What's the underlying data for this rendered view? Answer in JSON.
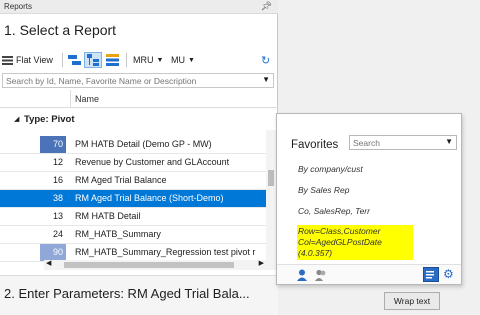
{
  "pane": {
    "title": "Reports",
    "pin_icon": "pin-icon"
  },
  "step1": "1. Select a Report",
  "toolbar": {
    "flat_view": "Flat View",
    "mru": "MRU",
    "mu": "MU"
  },
  "search": {
    "placeholder": "Search by Id, Name, Favorite Name or Description"
  },
  "grid": {
    "name_header": "Name",
    "group_label": "Type: Pivot",
    "rows": [
      {
        "num": "70",
        "name": "PM HATB Detail (Demo GP - MW)",
        "style": "hl"
      },
      {
        "num": "12",
        "name": "Revenue by Customer and GLAccount",
        "style": ""
      },
      {
        "num": "16",
        "name": "RM Aged Trial Balance",
        "style": ""
      },
      {
        "num": "38",
        "name": "RM Aged Trial Balance (Short-Demo)",
        "style": "sel"
      },
      {
        "num": "13",
        "name": "RM HATB Detail",
        "style": ""
      },
      {
        "num": "24",
        "name": "RM_HATB_Summary",
        "style": ""
      },
      {
        "num": "90",
        "name": "RM_HATB_Summary_Regression test pivot r",
        "style": "lhl"
      }
    ]
  },
  "step2": "2. Enter Parameters:  RM Aged Trial Bala...",
  "favorites": {
    "title": "Favorites",
    "search_placeholder": "Search",
    "items": [
      "By company/cust",
      "By Sales Rep",
      "Co, SalesRep, Terr"
    ],
    "highlighted": [
      "Row=Class,Customer",
      "Col=AgedGLPostDate",
      "(4.0.357)"
    ]
  },
  "wrap_text": "Wrap text",
  "colors": {
    "accent": "#0078d7",
    "highlight": "#ffff00",
    "id_badge": "#4a73b8"
  }
}
